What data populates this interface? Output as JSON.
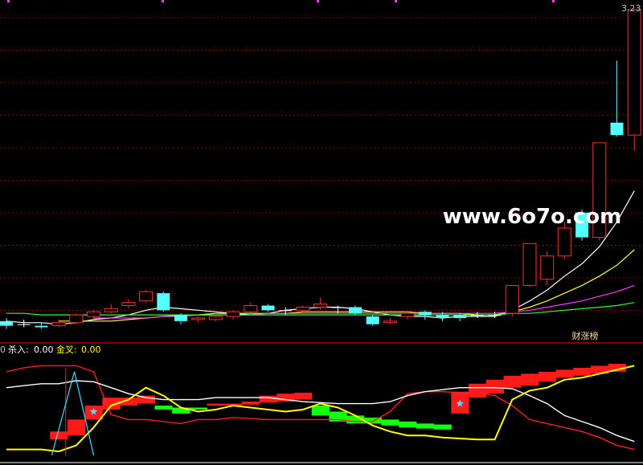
{
  "colors": {
    "background": "#000000",
    "grid": "#8b0000",
    "divider": "#b00000",
    "up": "#ff3030",
    "down": "#54ffff",
    "flat": "#ffffff",
    "ma5": "#ffffff",
    "ma10": "#ffff30",
    "ma20": "#ff40ff",
    "ma60": "#30ff30",
    "watermark": "#ffffff",
    "legend_label": "#ffff00",
    "sig_red": "#ff1a1a",
    "sig_green": "#11ff11",
    "fast_line": "#ff2020",
    "slow_line": "#ffffff",
    "signal_line": "#ffff00",
    "cyan_line": "#40e0ff"
  },
  "watermark": "www.6o7o.com",
  "price_label": "3.23",
  "badge": "财涨榜",
  "indicator_legend": {
    "prefix": "0",
    "kill_label": "杀入:",
    "kill_value": "0.00",
    "cross_label": "金叉:",
    "cross_value": "0.00"
  },
  "chart_data": [
    {
      "type": "candlestick",
      "panel": "price",
      "ylim": [
        1.1,
        3.26
      ],
      "candles": [
        {
          "o": 1.22,
          "h": 1.24,
          "l": 1.17,
          "c": 1.19
        },
        {
          "o": 1.2,
          "h": 1.23,
          "l": 1.18,
          "c": 1.2
        },
        {
          "o": 1.19,
          "h": 1.21,
          "l": 1.17,
          "c": 1.18
        },
        {
          "o": 1.19,
          "h": 1.23,
          "l": 1.18,
          "c": 1.21
        },
        {
          "o": 1.21,
          "h": 1.27,
          "l": 1.2,
          "c": 1.26
        },
        {
          "o": 1.25,
          "h": 1.29,
          "l": 1.24,
          "c": 1.28
        },
        {
          "o": 1.28,
          "h": 1.33,
          "l": 1.27,
          "c": 1.3
        },
        {
          "o": 1.32,
          "h": 1.36,
          "l": 1.3,
          "c": 1.34
        },
        {
          "o": 1.35,
          "h": 1.42,
          "l": 1.34,
          "c": 1.41
        },
        {
          "o": 1.4,
          "h": 1.41,
          "l": 1.28,
          "c": 1.29
        },
        {
          "o": 1.26,
          "h": 1.27,
          "l": 1.2,
          "c": 1.22
        },
        {
          "o": 1.23,
          "h": 1.25,
          "l": 1.21,
          "c": 1.24
        },
        {
          "o": 1.23,
          "h": 1.27,
          "l": 1.22,
          "c": 1.25
        },
        {
          "o": 1.25,
          "h": 1.29,
          "l": 1.23,
          "c": 1.28
        },
        {
          "o": 1.28,
          "h": 1.34,
          "l": 1.27,
          "c": 1.32
        },
        {
          "o": 1.32,
          "h": 1.33,
          "l": 1.28,
          "c": 1.29
        },
        {
          "o": 1.29,
          "h": 1.31,
          "l": 1.26,
          "c": 1.29
        },
        {
          "o": 1.29,
          "h": 1.32,
          "l": 1.27,
          "c": 1.31
        },
        {
          "o": 1.31,
          "h": 1.37,
          "l": 1.29,
          "c": 1.33
        },
        {
          "o": 1.31,
          "h": 1.32,
          "l": 1.27,
          "c": 1.31
        },
        {
          "o": 1.31,
          "h": 1.32,
          "l": 1.26,
          "c": 1.27
        },
        {
          "o": 1.25,
          "h": 1.26,
          "l": 1.19,
          "c": 1.2
        },
        {
          "o": 1.21,
          "h": 1.24,
          "l": 1.2,
          "c": 1.22
        },
        {
          "o": 1.25,
          "h": 1.28,
          "l": 1.23,
          "c": 1.27
        },
        {
          "o": 1.28,
          "h": 1.29,
          "l": 1.23,
          "c": 1.26
        },
        {
          "o": 1.26,
          "h": 1.28,
          "l": 1.22,
          "c": 1.24
        },
        {
          "o": 1.26,
          "h": 1.27,
          "l": 1.22,
          "c": 1.24
        },
        {
          "o": 1.26,
          "h": 1.28,
          "l": 1.24,
          "c": 1.26
        },
        {
          "o": 1.26,
          "h": 1.28,
          "l": 1.24,
          "c": 1.26
        },
        {
          "o": 1.27,
          "h": 1.45,
          "l": 1.25,
          "c": 1.45
        },
        {
          "o": 1.45,
          "h": 1.72,
          "l": 1.44,
          "c": 1.72
        },
        {
          "o": 1.49,
          "h": 1.67,
          "l": 1.45,
          "c": 1.64
        },
        {
          "o": 1.64,
          "h": 1.86,
          "l": 1.62,
          "c": 1.82
        },
        {
          "o": 1.92,
          "h": 1.94,
          "l": 1.74,
          "c": 1.76
        },
        {
          "o": 1.76,
          "h": 2.37,
          "l": 1.74,
          "c": 2.37
        },
        {
          "o": 2.5,
          "h": 2.9,
          "l": 2.41,
          "c": 2.42
        },
        {
          "o": 2.42,
          "h": 3.23,
          "l": 2.32,
          "c": 3.23
        }
      ],
      "ma": [
        {
          "name": "MA5",
          "color": "#ffffff",
          "values": [
            1.22,
            1.21,
            1.21,
            1.2,
            1.21,
            1.23,
            1.24,
            1.26,
            1.29,
            1.31,
            1.3,
            1.29,
            1.28,
            1.27,
            1.26,
            1.27,
            1.29,
            1.3,
            1.31,
            1.31,
            1.3,
            1.28,
            1.26,
            1.25,
            1.25,
            1.24,
            1.25,
            1.25,
            1.25,
            1.29,
            1.35,
            1.42,
            1.51,
            1.59,
            1.7,
            1.86,
            2.06
          ]
        },
        {
          "name": "MA10",
          "color": "#ffff30",
          "values": [
            null,
            null,
            null,
            1.22,
            1.22,
            1.22,
            1.22,
            1.23,
            1.24,
            1.25,
            1.26,
            1.26,
            1.27,
            1.27,
            1.27,
            1.27,
            1.27,
            1.28,
            1.28,
            1.28,
            1.28,
            1.28,
            1.28,
            1.28,
            1.27,
            1.27,
            1.27,
            1.26,
            1.26,
            1.28,
            1.31,
            1.35,
            1.4,
            1.45,
            1.51,
            1.58,
            1.68
          ]
        },
        {
          "name": "MA20",
          "color": "#ff40ff",
          "values": [
            null,
            null,
            null,
            null,
            null,
            1.24,
            1.24,
            1.24,
            1.24,
            1.25,
            1.25,
            1.26,
            1.26,
            1.26,
            1.26,
            1.27,
            1.27,
            1.27,
            1.27,
            1.27,
            1.27,
            1.27,
            1.27,
            1.27,
            1.27,
            1.27,
            1.27,
            1.27,
            1.27,
            1.28,
            1.29,
            1.31,
            1.33,
            1.35,
            1.38,
            1.41,
            1.45
          ]
        },
        {
          "name": "MA60",
          "color": "#30ff30",
          "values": [
            1.27,
            1.27,
            1.26,
            1.26,
            1.26,
            1.26,
            1.26,
            1.26,
            1.26,
            1.26,
            1.26,
            1.26,
            1.26,
            1.26,
            1.26,
            1.26,
            1.26,
            1.26,
            1.26,
            1.26,
            1.26,
            1.26,
            1.26,
            1.26,
            1.26,
            1.26,
            1.26,
            1.26,
            1.26,
            1.27,
            1.27,
            1.28,
            1.29,
            1.3,
            1.31,
            1.32,
            1.34
          ]
        }
      ]
    },
    {
      "type": "line",
      "panel": "indicator",
      "ylim": [
        0,
        100
      ],
      "x_count": 37,
      "series": [
        {
          "role": "fast",
          "color": "#ff2020",
          "values": [
            88,
            92,
            94,
            94,
            94,
            88,
            45,
            40,
            40,
            38,
            36,
            40,
            40,
            42,
            41,
            40,
            40,
            40,
            40,
            40,
            38,
            38,
            48,
            66,
            68,
            68,
            67,
            67,
            64,
            54,
            40,
            36,
            32,
            28,
            22,
            14,
            10
          ]
        },
        {
          "role": "slow",
          "color": "#ffffff",
          "values": [
            72,
            74,
            76,
            76,
            79,
            78,
            72,
            66,
            62,
            60,
            60,
            60,
            62,
            62,
            62,
            62,
            60,
            58,
            57,
            56,
            56,
            56,
            58,
            64,
            68,
            70,
            72,
            72,
            72,
            71,
            64,
            56,
            44,
            38,
            32,
            24,
            18
          ]
        },
        {
          "role": "signal",
          "color": "#ffff00",
          "values": [
            10,
            10,
            10,
            8,
            14,
            32,
            54,
            60,
            72,
            64,
            52,
            48,
            50,
            54,
            52,
            50,
            48,
            50,
            56,
            52,
            44,
            34,
            28,
            24,
            24,
            22,
            21,
            20,
            20,
            60,
            69,
            72,
            80,
            82,
            86,
            90,
            94
          ]
        }
      ],
      "bars": [
        {
          "x": 3,
          "y0": 20,
          "y1": 28,
          "color": "#ff1a1a"
        },
        {
          "x": 4,
          "y0": 24,
          "y1": 40,
          "color": "#ff1a1a"
        },
        {
          "x": 5,
          "y0": 40,
          "y1": 54,
          "color": "#ff1a1a"
        },
        {
          "x": 6,
          "y0": 50,
          "y1": 62,
          "color": "#ff1a1a"
        },
        {
          "x": 7,
          "y0": 54,
          "y1": 62,
          "color": "#ff1a1a"
        },
        {
          "x": 8,
          "y0": 56,
          "y1": 64,
          "color": "#ff1a1a"
        },
        {
          "x": 9,
          "y0": 50,
          "y1": 54,
          "color": "#11ff11"
        },
        {
          "x": 10,
          "y0": 46,
          "y1": 52,
          "color": "#11ff11"
        },
        {
          "x": 11,
          "y0": 50,
          "y1": 52,
          "color": "#11ff11"
        },
        {
          "x": 12,
          "y0": 54,
          "y1": 56,
          "color": "#ff1a1a"
        },
        {
          "x": 13,
          "y0": 54,
          "y1": 56,
          "color": "#ff1a1a"
        },
        {
          "x": 14,
          "y0": 55,
          "y1": 58,
          "color": "#ff1a1a"
        },
        {
          "x": 15,
          "y0": 57,
          "y1": 64,
          "color": "#ff1a1a"
        },
        {
          "x": 16,
          "y0": 58,
          "y1": 66,
          "color": "#ff1a1a"
        },
        {
          "x": 17,
          "y0": 60,
          "y1": 67,
          "color": "#ff1a1a"
        },
        {
          "x": 18,
          "y0": 44,
          "y1": 54,
          "color": "#11ff11"
        },
        {
          "x": 19,
          "y0": 38,
          "y1": 48,
          "color": "#11ff11"
        },
        {
          "x": 20,
          "y0": 36,
          "y1": 44,
          "color": "#11ff11"
        },
        {
          "x": 21,
          "y0": 36,
          "y1": 42,
          "color": "#11ff11"
        },
        {
          "x": 22,
          "y0": 34,
          "y1": 40,
          "color": "#11ff11"
        },
        {
          "x": 23,
          "y0": 32,
          "y1": 38,
          "color": "#11ff11"
        },
        {
          "x": 24,
          "y0": 31,
          "y1": 36,
          "color": "#11ff11"
        },
        {
          "x": 25,
          "y0": 30,
          "y1": 35,
          "color": "#11ff11"
        },
        {
          "x": 26,
          "y0": 46,
          "y1": 68,
          "color": "#ff1a1a"
        },
        {
          "x": 27,
          "y0": 62,
          "y1": 76,
          "color": "#ff1a1a"
        },
        {
          "x": 28,
          "y0": 66,
          "y1": 80,
          "color": "#ff1a1a"
        },
        {
          "x": 29,
          "y0": 72,
          "y1": 84,
          "color": "#ff1a1a"
        },
        {
          "x": 30,
          "y0": 74,
          "y1": 86,
          "color": "#ff1a1a"
        },
        {
          "x": 31,
          "y0": 78,
          "y1": 88,
          "color": "#ff1a1a"
        },
        {
          "x": 32,
          "y0": 82,
          "y1": 90,
          "color": "#ff1a1a"
        },
        {
          "x": 33,
          "y0": 84,
          "y1": 92,
          "color": "#ff1a1a"
        },
        {
          "x": 34,
          "y0": 86,
          "y1": 94,
          "color": "#ff1a1a"
        },
        {
          "x": 35,
          "y0": 88,
          "y1": 96,
          "color": "#ff1a1a"
        }
      ],
      "markers": [
        {
          "x": 5,
          "y": 48,
          "shape": "star",
          "color": "#40e0ff"
        },
        {
          "x": 26,
          "y": 56,
          "shape": "star",
          "color": "#40e0ff"
        }
      ],
      "spike": {
        "color": "#40e0ff",
        "points": [
          [
            2.6,
            4
          ],
          [
            3.9,
            88
          ],
          [
            5.0,
            4
          ]
        ]
      }
    }
  ]
}
